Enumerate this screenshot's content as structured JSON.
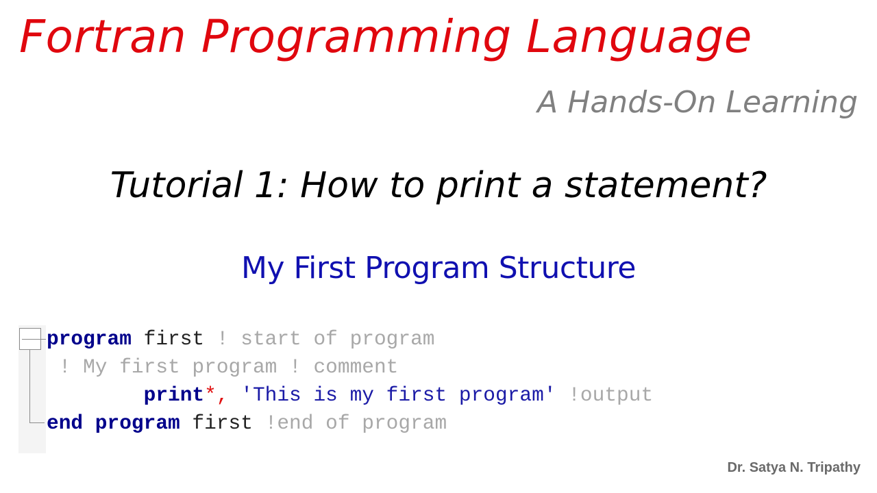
{
  "slide": {
    "title": "Fortran Programming Language",
    "subtitle": "A Hands-On Learning",
    "tutorial_heading": "Tutorial 1: How to print a statement?",
    "section_heading": "My First Program Structure",
    "author": "Dr. Satya N. Tripathy"
  },
  "code": {
    "fold_icon": "fold-collapse-minus-icon",
    "lines": [
      {
        "tokens": [
          {
            "text": "program",
            "kind": "keyword"
          },
          {
            "text": " first",
            "kind": "identifier"
          },
          {
            "text": " ! start of program",
            "kind": "comment"
          }
        ]
      },
      {
        "tokens": [
          {
            "text": " ! My first program ! comment",
            "kind": "comment"
          }
        ]
      },
      {
        "tokens": [
          {
            "text": "        ",
            "kind": "identifier"
          },
          {
            "text": "print",
            "kind": "keyword"
          },
          {
            "text": "*,",
            "kind": "operator"
          },
          {
            "text": " 'This is my first program'",
            "kind": "string"
          },
          {
            "text": " !output",
            "kind": "comment"
          }
        ]
      },
      {
        "tokens": [
          {
            "text": "end program",
            "kind": "keyword"
          },
          {
            "text": " first",
            "kind": "identifier"
          },
          {
            "text": " !end of program",
            "kind": "comment"
          }
        ]
      }
    ]
  },
  "colors": {
    "title": "#e0070e",
    "subtitle": "#808080",
    "section": "#1010b0",
    "keyword": "#00008b",
    "comment": "#a8a8a8",
    "operator": "#e01010",
    "string": "#1a1aa6"
  }
}
